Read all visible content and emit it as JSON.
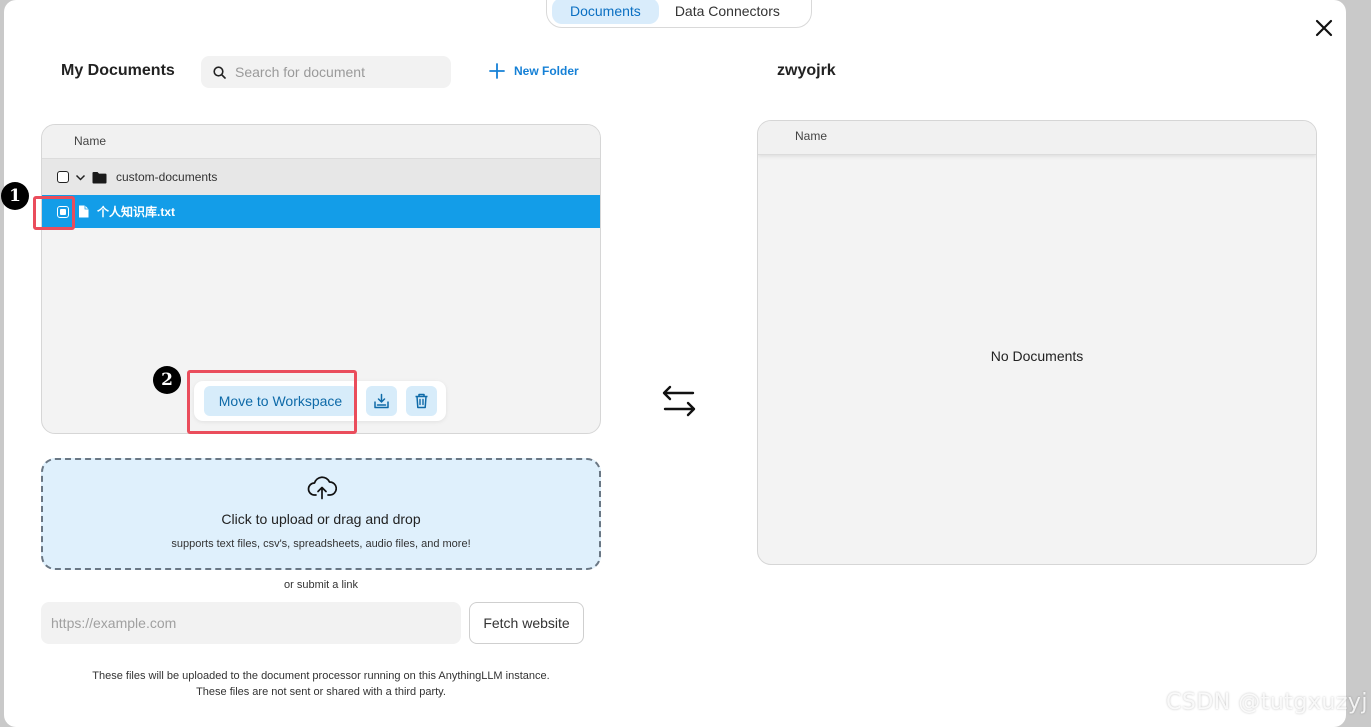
{
  "tabs": [
    {
      "label": "Documents",
      "active": true
    },
    {
      "label": "Data Connectors",
      "active": false
    }
  ],
  "left": {
    "title": "My Documents",
    "search_placeholder": "Search for document",
    "new_folder_label": "New Folder",
    "column_header": "Name",
    "folder": {
      "name": "custom-documents",
      "expanded": true,
      "checked": false
    },
    "files": [
      {
        "name": "个人知识库.txt",
        "selected": true,
        "checked": true
      }
    ],
    "actions": {
      "move_label": "Move to Workspace",
      "download_icon": "download-icon",
      "delete_icon": "trash-icon"
    }
  },
  "right": {
    "title": "zwyojrk",
    "column_header": "Name",
    "empty_text": "No Documents"
  },
  "upload": {
    "title": "Click to upload or drag and drop",
    "subtitle": "supports text files, csv's, spreadsheets, audio files, and more!",
    "or_link": "or submit a link",
    "url_placeholder": "https://example.com",
    "fetch_label": "Fetch website",
    "footnote_1": "These files will be uploaded to the document processor running on this AnythingLLM instance.",
    "footnote_2": "These files are not sent or shared with a third party."
  },
  "annotations": {
    "badge_1": "1",
    "badge_2": "2"
  },
  "watermark": "CSDN @tutgxuzyj",
  "colors": {
    "accent": "#139de8",
    "highlight": "#ea4d5c",
    "upload_bg": "#dff0fc"
  }
}
